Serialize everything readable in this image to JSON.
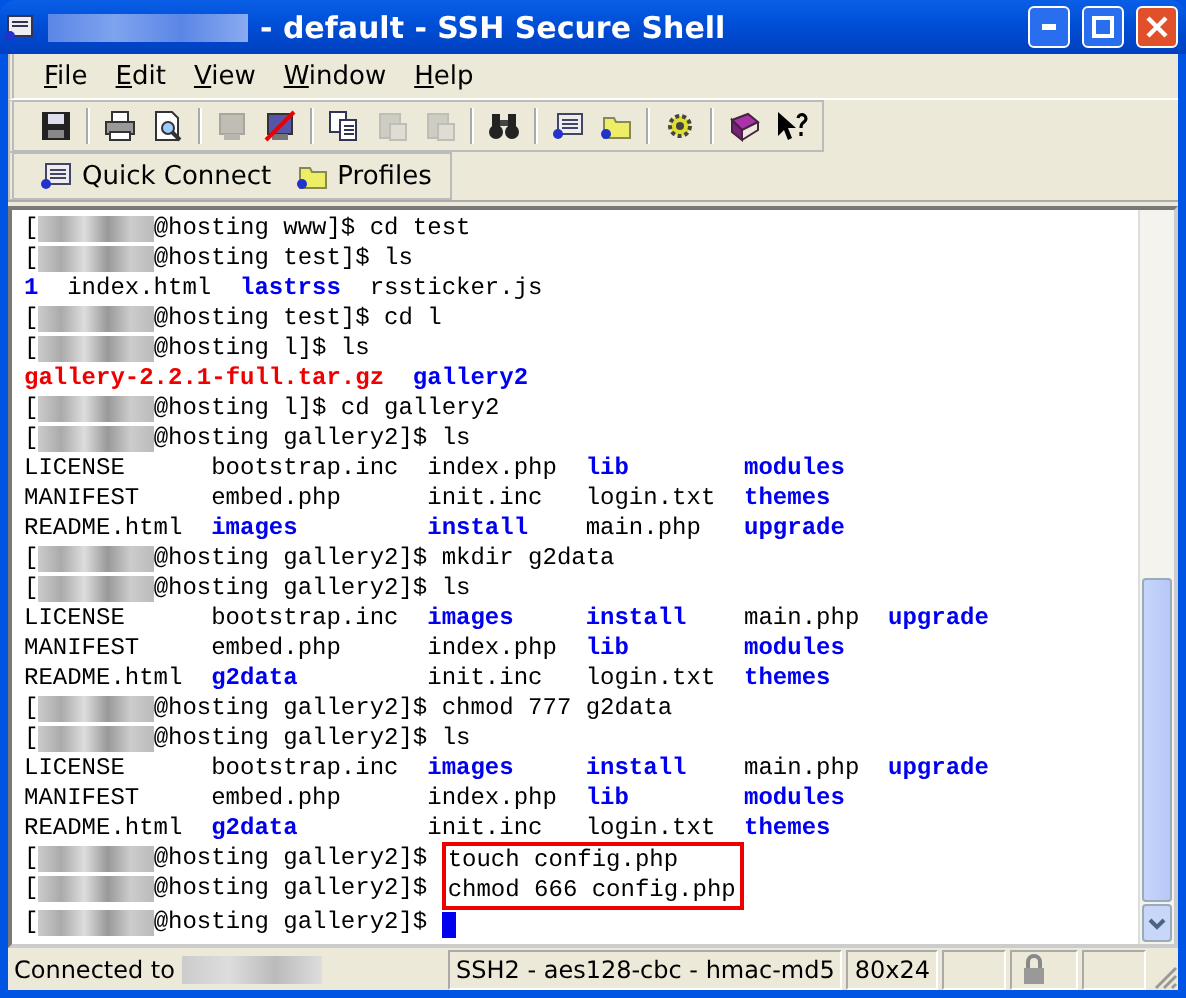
{
  "window": {
    "title": "- default - SSH Secure Shell",
    "title_redacted": true
  },
  "menu": [
    {
      "label": "File"
    },
    {
      "label": "Edit"
    },
    {
      "label": "View"
    },
    {
      "label": "Window"
    },
    {
      "label": "Help"
    }
  ],
  "toolbar": [
    {
      "kind": "save",
      "disabled": false
    },
    {
      "kind": "sep"
    },
    {
      "kind": "print",
      "disabled": false
    },
    {
      "kind": "preview",
      "disabled": false
    },
    {
      "kind": "sep"
    },
    {
      "kind": "connect",
      "disabled": true
    },
    {
      "kind": "disconnect",
      "disabled": false
    },
    {
      "kind": "sep"
    },
    {
      "kind": "copy",
      "disabled": false
    },
    {
      "kind": "paste",
      "disabled": true
    },
    {
      "kind": "paste",
      "disabled": true
    },
    {
      "kind": "sep"
    },
    {
      "kind": "find",
      "disabled": false
    },
    {
      "kind": "sep"
    },
    {
      "kind": "terminal",
      "disabled": false
    },
    {
      "kind": "folder",
      "disabled": false
    },
    {
      "kind": "sep"
    },
    {
      "kind": "settings",
      "disabled": false
    },
    {
      "kind": "sep"
    },
    {
      "kind": "book",
      "disabled": false
    },
    {
      "kind": "whatsthis",
      "disabled": false
    }
  ],
  "quickbar": [
    {
      "kind": "connect",
      "label": "Quick Connect"
    },
    {
      "kind": "profiles",
      "label": "Profiles"
    }
  ],
  "terminal": {
    "lines": [
      {
        "kind": "prompt",
        "open": "[",
        "redacted": true,
        "text": "@hosting www]$ cd test"
      },
      {
        "kind": "prompt",
        "open": "[",
        "redacted": true,
        "text": "@hosting test]$ ls"
      },
      {
        "kind": "listing",
        "rows": [
          [
            {
              "kind": "dir",
              "text": "1"
            },
            {
              "kind": "file",
              "text": "index.html"
            },
            {
              "kind": "dir",
              "text": "lastrss"
            },
            {
              "kind": "file",
              "text": "rssticker.js"
            }
          ]
        ]
      },
      {
        "kind": "prompt",
        "open": "[",
        "redacted": true,
        "text": "@hosting test]$ cd l"
      },
      {
        "kind": "prompt",
        "open": "[",
        "redacted": true,
        "text": "@hosting l]$ ls"
      },
      {
        "kind": "listing",
        "rows": [
          [
            {
              "kind": "archive",
              "text": "gallery-2.2.1-full.tar.gz"
            },
            {
              "kind": "dir",
              "text": "gallery2"
            }
          ]
        ]
      },
      {
        "kind": "prompt",
        "open": "[",
        "redacted": true,
        "text": "@hosting l]$ cd gallery2"
      },
      {
        "kind": "prompt",
        "open": "[",
        "redacted": true,
        "text": "@hosting gallery2]$ ls"
      },
      {
        "kind": "listing",
        "rows": [
          [
            {
              "kind": "file",
              "text": "LICENSE"
            },
            {
              "kind": "file",
              "text": "bootstrap.inc"
            },
            {
              "kind": "file",
              "text": "index.php"
            },
            {
              "kind": "dir",
              "text": "lib"
            },
            {
              "kind": "dir",
              "text": "modules"
            }
          ],
          [
            {
              "kind": "file",
              "text": "MANIFEST"
            },
            {
              "kind": "file",
              "text": "embed.php"
            },
            {
              "kind": "file",
              "text": "init.inc"
            },
            {
              "kind": "file",
              "text": "login.txt"
            },
            {
              "kind": "dir",
              "text": "themes"
            }
          ],
          [
            {
              "kind": "file",
              "text": "README.html"
            },
            {
              "kind": "dir",
              "text": "images"
            },
            {
              "kind": "dir",
              "text": "install"
            },
            {
              "kind": "file",
              "text": "main.php"
            },
            {
              "kind": "dir",
              "text": "upgrade"
            }
          ]
        ]
      },
      {
        "kind": "prompt",
        "open": "[",
        "redacted": true,
        "text": "@hosting gallery2]$ mkdir g2data"
      },
      {
        "kind": "prompt",
        "open": "[",
        "redacted": true,
        "text": "@hosting gallery2]$ ls"
      },
      {
        "kind": "listing",
        "rows": [
          [
            {
              "kind": "file",
              "text": "LICENSE"
            },
            {
              "kind": "file",
              "text": "bootstrap.inc"
            },
            {
              "kind": "dir",
              "text": "images"
            },
            {
              "kind": "dir",
              "text": "install"
            },
            {
              "kind": "file",
              "text": "main.php"
            },
            {
              "kind": "dir",
              "text": "upgrade"
            }
          ],
          [
            {
              "kind": "file",
              "text": "MANIFEST"
            },
            {
              "kind": "file",
              "text": "embed.php"
            },
            {
              "kind": "file",
              "text": "index.php"
            },
            {
              "kind": "dir",
              "text": "lib"
            },
            {
              "kind": "dir",
              "text": "modules"
            }
          ],
          [
            {
              "kind": "file",
              "text": "README.html"
            },
            {
              "kind": "dir",
              "text": "g2data"
            },
            {
              "kind": "file",
              "text": "init.inc"
            },
            {
              "kind": "file",
              "text": "login.txt"
            },
            {
              "kind": "dir",
              "text": "themes"
            }
          ]
        ]
      },
      {
        "kind": "prompt",
        "open": "[",
        "redacted": true,
        "text": "@hosting gallery2]$ chmod 777 g2data"
      },
      {
        "kind": "prompt",
        "open": "[",
        "redacted": true,
        "text": "@hosting gallery2]$ ls"
      },
      {
        "kind": "listing",
        "rows": [
          [
            {
              "kind": "file",
              "text": "LICENSE"
            },
            {
              "kind": "file",
              "text": "bootstrap.inc"
            },
            {
              "kind": "dir",
              "text": "images"
            },
            {
              "kind": "dir",
              "text": "install"
            },
            {
              "kind": "file",
              "text": "main.php"
            },
            {
              "kind": "dir",
              "text": "upgrade"
            }
          ],
          [
            {
              "kind": "file",
              "text": "MANIFEST"
            },
            {
              "kind": "file",
              "text": "embed.php"
            },
            {
              "kind": "file",
              "text": "index.php"
            },
            {
              "kind": "dir",
              "text": "lib"
            },
            {
              "kind": "dir",
              "text": "modules"
            }
          ],
          [
            {
              "kind": "file",
              "text": "README.html"
            },
            {
              "kind": "dir",
              "text": "g2data"
            },
            {
              "kind": "file",
              "text": "init.inc"
            },
            {
              "kind": "file",
              "text": "login.txt"
            },
            {
              "kind": "dir",
              "text": "themes"
            }
          ]
        ]
      },
      {
        "kind": "boxed",
        "lines": [
          {
            "open": "[",
            "redacted": true,
            "prompt": "@hosting gallery2]$",
            "command": "touch config.php"
          },
          {
            "open": "[",
            "redacted": true,
            "prompt": "@hosting gallery2]$",
            "command": "chmod 666 config.php"
          }
        ]
      },
      {
        "kind": "prompt",
        "open": "[",
        "redacted": true,
        "text": "@hosting gallery2]$",
        "cursor": true
      }
    ]
  },
  "status_bar": {
    "connection": "Connected to",
    "host_redacted": true,
    "cipher": "SSH2 - aes128-cbc - hmac-md5",
    "size": "80x24"
  }
}
